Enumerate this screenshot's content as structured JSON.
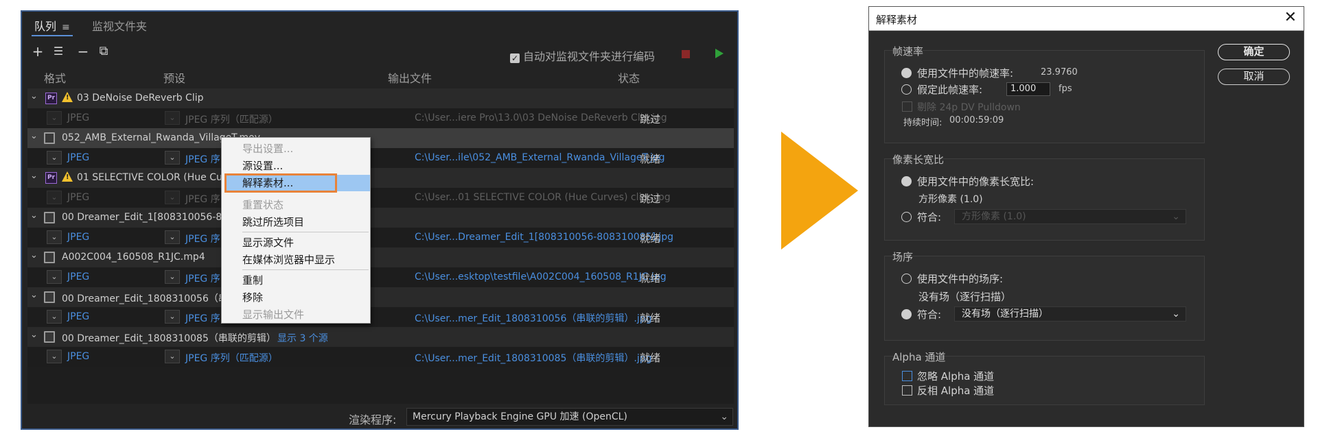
{
  "queue": {
    "tabs": {
      "queue": "队列",
      "queue_menu": "≡",
      "watch": "监视文件夹"
    },
    "toolbar": {
      "add": "+",
      "settings": "☰",
      "remove": "−",
      "duplicate": "⧉",
      "auto_encode": "自动对监视文件夹进行编码",
      "auto_encode_checked": "✓"
    },
    "columns": {
      "format": "格式",
      "preset": "预设",
      "output": "输出文件",
      "status": "状态"
    },
    "rows": [
      {
        "name": "03 DeNoise DeReverb Clip",
        "format": "JPEG",
        "preset": "JPEG 序列（匹配源）",
        "output": "C:\\User...iere Pro\\13.0\\03 DeNoise DeReverb Clip.jpg",
        "status": "跳过"
      },
      {
        "name": "052_AMB_External_Rwanda_VillageT.mov",
        "format": "JPEG",
        "preset": "JPEG 序",
        "output": "C:\\User...ile\\052_AMB_External_Rwanda_VillageT.jpg",
        "status": "就绪"
      },
      {
        "name": "01 SELECTIVE COLOR (Hue Curv",
        "format": "JPEG",
        "preset": "JPEG 序",
        "output": "C:\\User...01 SELECTIVE COLOR (Hue Curves) clips.jpg",
        "status": "跳过"
      },
      {
        "name": "00 Dreamer_Edit_1[808310056-808",
        "format": "JPEG",
        "preset": "JPEG 序",
        "output": "C:\\User...Dreamer_Edit_1[808310056-808310085].jpg",
        "status": "就绪"
      },
      {
        "name": "A002C004_160508_R1JC.mp4",
        "format": "JPEG",
        "preset": "JPEG 序",
        "output": "C:\\User...esktop\\testfile\\A002C004_160508_R1JC.jpg",
        "status": "就绪"
      },
      {
        "name": "00 Dreamer_Edit_1808310056（串",
        "format": "JPEG",
        "preset": "JPEG 序",
        "output": "C:\\User...mer_Edit_1808310056（串联的剪辑）.jpg",
        "status": "就绪"
      },
      {
        "name": "00 Dreamer_Edit_1808310085（串联的剪辑）",
        "extra": "显示 3 个源",
        "format": "JPEG",
        "preset": "JPEG 序列（匹配源）",
        "output": "C:\\User...mer_Edit_1808310085（串联的剪辑）.jpg",
        "status": "就绪"
      }
    ],
    "renderer_label": "渲染程序:",
    "renderer_value": "Mercury Playback Engine GPU 加速 (OpenCL)"
  },
  "context_menu": {
    "items": [
      "导出设置...",
      "源设置...",
      "解释素材...",
      "重置状态",
      "跳过所选项目",
      "显示源文件",
      "在媒体浏览器中显示",
      "重制",
      "移除",
      "显示输出文件"
    ]
  },
  "dialog": {
    "title": "解释素材",
    "close": "✕",
    "frame_rate": {
      "title": "帧速率",
      "use_file": "使用文件中的帧速率:",
      "file_value": "23.9760",
      "assume": "假定此帧速率:",
      "assume_value": "1.000",
      "unit": "fps",
      "pulldown": "剔除 24p DV Pulldown",
      "duration_label": "持续时间:",
      "duration_value": "00:00:59:09"
    },
    "pixel_aspect": {
      "title": "像素长宽比",
      "use_file": "使用文件中的像素长宽比:",
      "file_value": "方形像素 (1.0)",
      "conform": "符合:",
      "conform_value": "方形像素 (1.0)"
    },
    "field_order": {
      "title": "场序",
      "use_file": "使用文件中的场序:",
      "file_value": "没有场（逐行扫描）",
      "conform": "符合:",
      "conform_value": "没有场（逐行扫描）"
    },
    "alpha": {
      "title": "Alpha 通道",
      "ignore": "忽略 Alpha 通道",
      "invert": "反相 Alpha 通道"
    },
    "ok": "确定",
    "cancel": "取消"
  },
  "colors": {
    "accent_blue": "#4a8fe0",
    "arrow": "#f4a40f",
    "highlight_outline": "#e8833a"
  }
}
